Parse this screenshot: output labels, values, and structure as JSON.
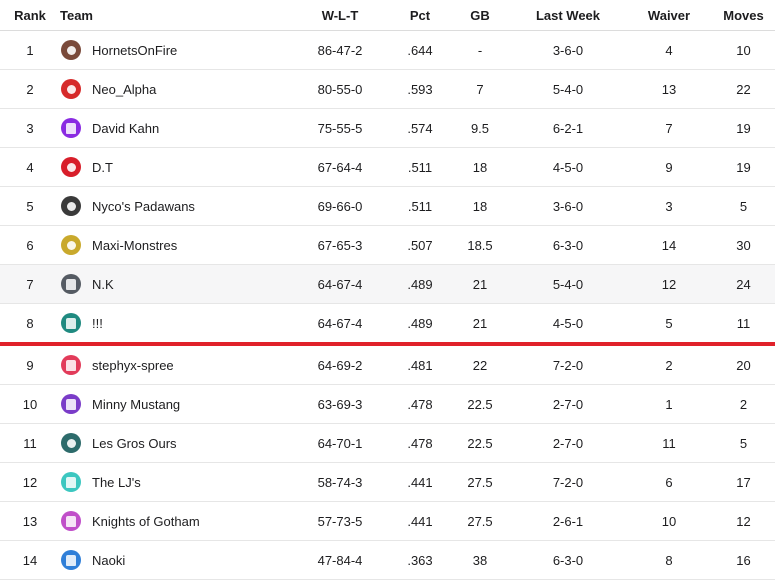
{
  "columns": {
    "rank": "Rank",
    "team": "Team",
    "wlt": "W-L-T",
    "pct": "Pct",
    "gb": "GB",
    "last_week": "Last Week",
    "waiver": "Waiver",
    "moves": "Moves"
  },
  "rows": [
    {
      "rank": "1",
      "team": "HornetsOnFire",
      "wlt": "86-47-2",
      "pct": ".644",
      "gb": "-",
      "last_week": "3-6-0",
      "waiver": "4",
      "moves": "10",
      "logo_color": "#7a4a3a",
      "logo_icon": "hornet-logo-icon"
    },
    {
      "rank": "2",
      "team": "Neo_Alpha",
      "wlt": "80-55-0",
      "pct": ".593",
      "gb": "7",
      "last_week": "5-4-0",
      "waiver": "13",
      "moves": "22",
      "logo_color": "#d62a2a",
      "logo_icon": "alpha-logo-icon"
    },
    {
      "rank": "3",
      "team": "David Kahn",
      "wlt": "75-55-5",
      "pct": ".574",
      "gb": "9.5",
      "last_week": "6-2-1",
      "waiver": "7",
      "moves": "19",
      "logo_color": "#8a2be2",
      "logo_icon": "jersey-icon"
    },
    {
      "rank": "4",
      "team": "D.T",
      "wlt": "67-64-4",
      "pct": ".511",
      "gb": "18",
      "last_week": "4-5-0",
      "waiver": "9",
      "moves": "19",
      "logo_color": "#d81e2a",
      "logo_icon": "bull-logo-icon"
    },
    {
      "rank": "5",
      "team": "Nyco's Padawans",
      "wlt": "69-66-0",
      "pct": ".511",
      "gb": "18",
      "last_week": "3-6-0",
      "waiver": "3",
      "moves": "5",
      "logo_color": "#3a3a3a",
      "logo_icon": "padawan-logo-icon"
    },
    {
      "rank": "6",
      "team": "Maxi-Monstres",
      "wlt": "67-65-3",
      "pct": ".507",
      "gb": "18.5",
      "last_week": "6-3-0",
      "waiver": "14",
      "moves": "30",
      "logo_color": "#c9a92c",
      "logo_icon": "monster-logo-icon"
    },
    {
      "rank": "7",
      "team": "N.K",
      "wlt": "64-67-4",
      "pct": ".489",
      "gb": "21",
      "last_week": "5-4-0",
      "waiver": "12",
      "moves": "24",
      "logo_color": "#555b63",
      "logo_icon": "jersey-icon"
    },
    {
      "rank": "8",
      "team": "!!!",
      "wlt": "64-67-4",
      "pct": ".489",
      "gb": "21",
      "last_week": "4-5-0",
      "waiver": "5",
      "moves": "11",
      "logo_color": "#1f8a80",
      "logo_icon": "jersey-icon"
    },
    {
      "rank": "9",
      "team": "stephyx-spree",
      "wlt": "64-69-2",
      "pct": ".481",
      "gb": "22",
      "last_week": "7-2-0",
      "waiver": "2",
      "moves": "20",
      "logo_color": "#e23b5a",
      "logo_icon": "jersey-icon"
    },
    {
      "rank": "10",
      "team": "Minny Mustang",
      "wlt": "63-69-3",
      "pct": ".478",
      "gb": "22.5",
      "last_week": "2-7-0",
      "waiver": "1",
      "moves": "2",
      "logo_color": "#7a3cc8",
      "logo_icon": "jersey-icon"
    },
    {
      "rank": "11",
      "team": "Les Gros Ours",
      "wlt": "64-70-1",
      "pct": ".478",
      "gb": "22.5",
      "last_week": "2-7-0",
      "waiver": "11",
      "moves": "5",
      "logo_color": "#2d6b6b",
      "logo_icon": "bear-logo-icon"
    },
    {
      "rank": "12",
      "team": "The LJ's",
      "wlt": "58-74-3",
      "pct": ".441",
      "gb": "27.5",
      "last_week": "7-2-0",
      "waiver": "6",
      "moves": "17",
      "logo_color": "#3cc7c0",
      "logo_icon": "jersey-icon"
    },
    {
      "rank": "13",
      "team": "Knights of Gotham",
      "wlt": "57-73-5",
      "pct": ".441",
      "gb": "27.5",
      "last_week": "2-6-1",
      "waiver": "10",
      "moves": "12",
      "logo_color": "#c04ec9",
      "logo_icon": "jersey-icon"
    },
    {
      "rank": "14",
      "team": "Naoki",
      "wlt": "47-84-4",
      "pct": ".363",
      "gb": "38",
      "last_week": "6-3-0",
      "waiver": "8",
      "moves": "16",
      "logo_color": "#2f7fd8",
      "logo_icon": "jersey-icon"
    }
  ],
  "playoff_cutoff_color": "#e0212a",
  "alt_rows": [
    "7"
  ]
}
